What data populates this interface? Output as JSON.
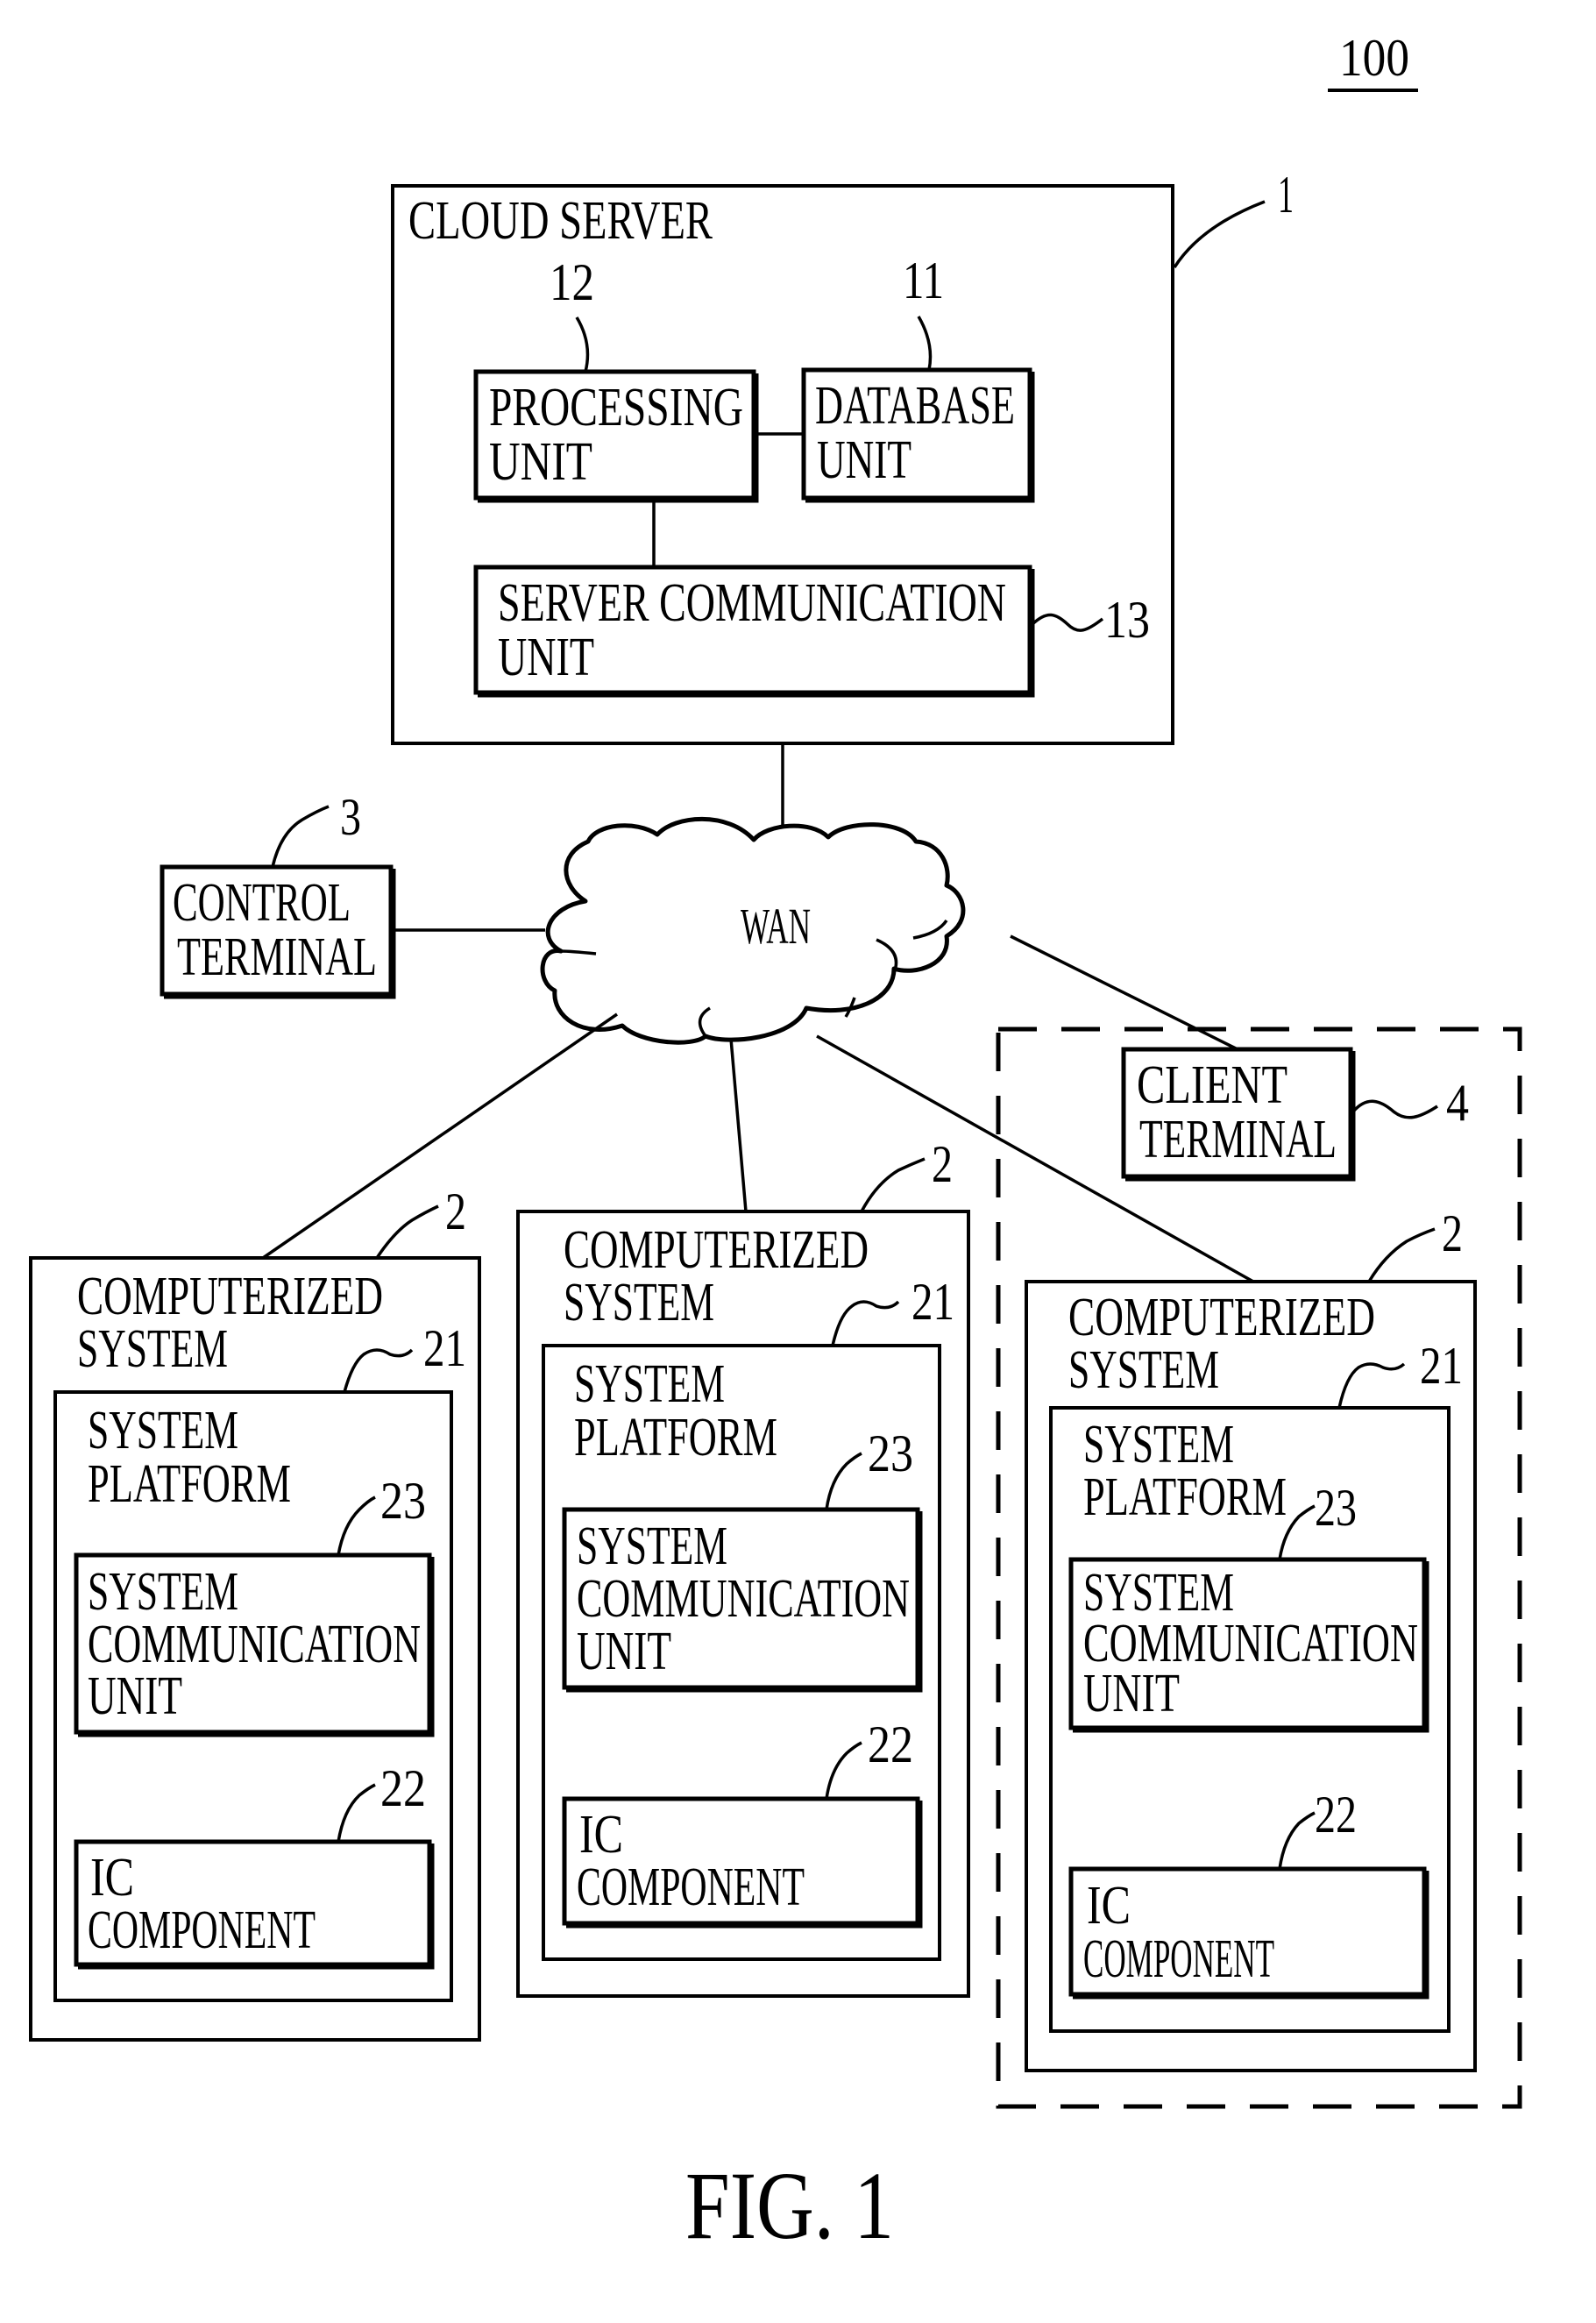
{
  "figure": {
    "system_ref": "100",
    "caption": "FIG. 1",
    "colors": {
      "ink": "#000000",
      "paper": "#ffffff"
    }
  },
  "cloud_server": {
    "title": "CLOUD SERVER",
    "ref": "1",
    "processing_unit": {
      "ref": "12",
      "lines": [
        "PROCESSING",
        "UNIT"
      ]
    },
    "database_unit": {
      "ref": "11",
      "lines": [
        "DATABASE",
        "UNIT"
      ]
    },
    "server_communication_unit": {
      "ref": "13",
      "lines": [
        "SERVER COMMUNICATION",
        "UNIT"
      ]
    }
  },
  "network": {
    "label": "WAN"
  },
  "control_terminal": {
    "ref": "3",
    "lines": [
      "CONTROL",
      "TERMINAL"
    ]
  },
  "client_terminal": {
    "ref": "4",
    "lines": [
      "CLIENT",
      "TERMINAL"
    ]
  },
  "computerized_systems": [
    {
      "ref": "2",
      "lines": [
        "COMPUTERIZED",
        "SYSTEM"
      ],
      "system_platform": {
        "ref": "21",
        "lines": [
          "SYSTEM",
          "PLATFORM"
        ]
      },
      "system_communication_unit": {
        "ref": "23",
        "lines": [
          "SYSTEM",
          "COMMUNICATION",
          "UNIT"
        ]
      },
      "ic_component": {
        "ref": "22",
        "lines": [
          "IC",
          "COMPONENT"
        ]
      }
    },
    {
      "ref": "2",
      "lines": [
        "COMPUTERIZED",
        "SYSTEM"
      ],
      "system_platform": {
        "ref": "21",
        "lines": [
          "SYSTEM",
          "PLATFORM"
        ]
      },
      "system_communication_unit": {
        "ref": "23",
        "lines": [
          "SYSTEM",
          "COMMUNICATION",
          "UNIT"
        ]
      },
      "ic_component": {
        "ref": "22",
        "lines": [
          "IC",
          "COMPONENT"
        ]
      }
    },
    {
      "ref": "2",
      "lines": [
        "COMPUTERIZED",
        "SYSTEM"
      ],
      "system_platform": {
        "ref": "21",
        "lines": [
          "SYSTEM",
          "PLATFORM"
        ]
      },
      "system_communication_unit": {
        "ref": "23",
        "lines": [
          "SYSTEM",
          "COMMUNICATION",
          "UNIT"
        ]
      },
      "ic_component": {
        "ref": "22",
        "lines": [
          "IC",
          "COMPONENT"
        ]
      }
    }
  ]
}
